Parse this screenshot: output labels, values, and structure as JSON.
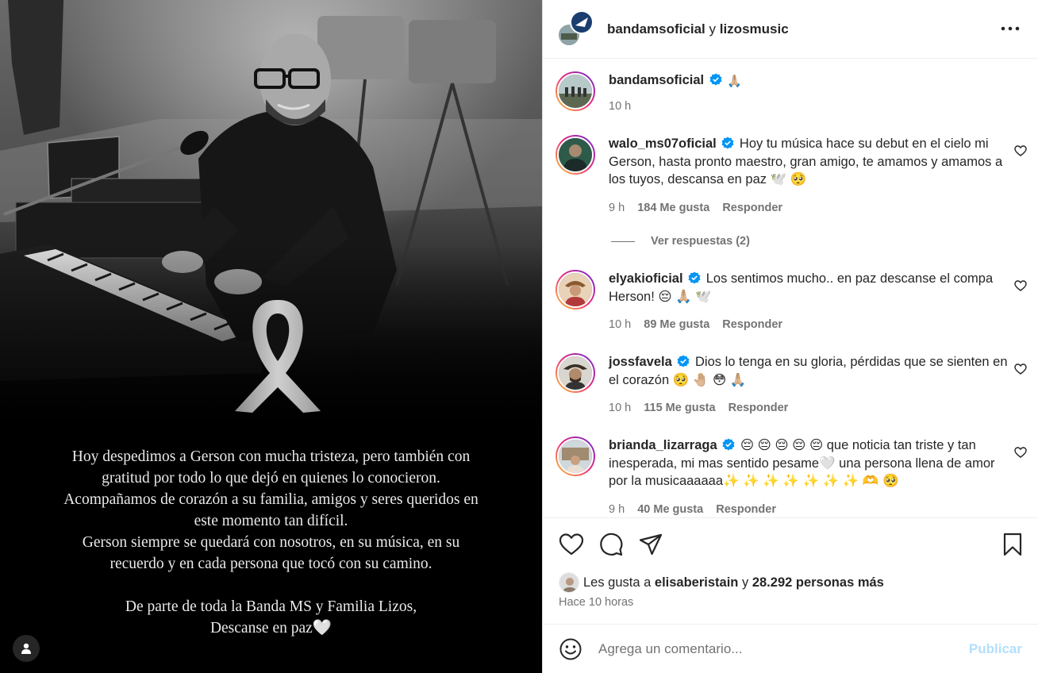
{
  "header": {
    "author_primary": "bandamsoficial",
    "connector": "y",
    "author_secondary": "lizosmusic",
    "more_icon": "more-horizontal-icon"
  },
  "media": {
    "caption_lines": [
      "Hoy despedimos a Gerson con mucha tristeza, pero también con",
      "gratitud por todo lo que dejó en quienes lo conocieron.",
      "Acompañamos de corazón a su familia, amigos y seres queridos en",
      "este momento tan difícil.",
      "Gerson siempre se quedará con nosotros, en su música, en su",
      "recuerdo y en cada persona que tocó con su camino."
    ],
    "sign_line1": "De parte de toda la Banda MS y Familia Lizos,",
    "sign_line2": "Descanse en paz🤍",
    "tag_icon": "user-tag-icon"
  },
  "comments": [
    {
      "user": "bandamsoficial",
      "verified": true,
      "text": "🙏🏼",
      "time": "10 h",
      "likes": "",
      "reply": ""
    },
    {
      "user": "walo_ms07oficial",
      "verified": true,
      "text": "Hoy tu música hace su debut en el cielo mi Gerson, hasta pronto maestro, gran amigo, te amamos y amamos a los tuyos, descansa en paz 🕊️ 🥺",
      "time": "9 h",
      "likes": "184 Me gusta",
      "reply": "Responder"
    },
    {
      "user": "elyakioficial",
      "verified": true,
      "text": "Los sentimos mucho.. en paz descanse el compa Herson! 😔 🙏🏼 🕊️",
      "time": "10 h",
      "likes": "89 Me gusta",
      "reply": "Responder"
    },
    {
      "user": "jossfavela",
      "verified": true,
      "text": "Dios lo tenga en su gloria, pérdidas que se sienten en el corazón 🥺 🤚🏼 😳 🙏🏼",
      "time": "10 h",
      "likes": "115 Me gusta",
      "reply": "Responder"
    },
    {
      "user": "brianda_lizarraga",
      "verified": true,
      "text": "😔 😔 😔 😔 😔  que noticia tan triste y tan inesperada, mi mas sentido pesame🤍  una persona llena de amor por la musicaaaaaa✨ ✨ ✨ ✨ ✨ ✨ ✨ 🫶 🥺",
      "time": "9 h",
      "likes": "40 Me gusta",
      "reply": "Responder"
    }
  ],
  "view_replies": "Ver respuestas (2)",
  "likes_summary": {
    "prefix": "Les gusta a",
    "user": "elisaberistain",
    "connector": "y",
    "others": "28.292 personas más"
  },
  "post_time": "Hace 10 horas",
  "add_comment": {
    "placeholder": "Agrega un comentario...",
    "publish_label": "Publicar"
  },
  "colors": {
    "verified": "#0095f6",
    "publish_disabled": "#b2dffc",
    "secondary_text": "#737373"
  }
}
